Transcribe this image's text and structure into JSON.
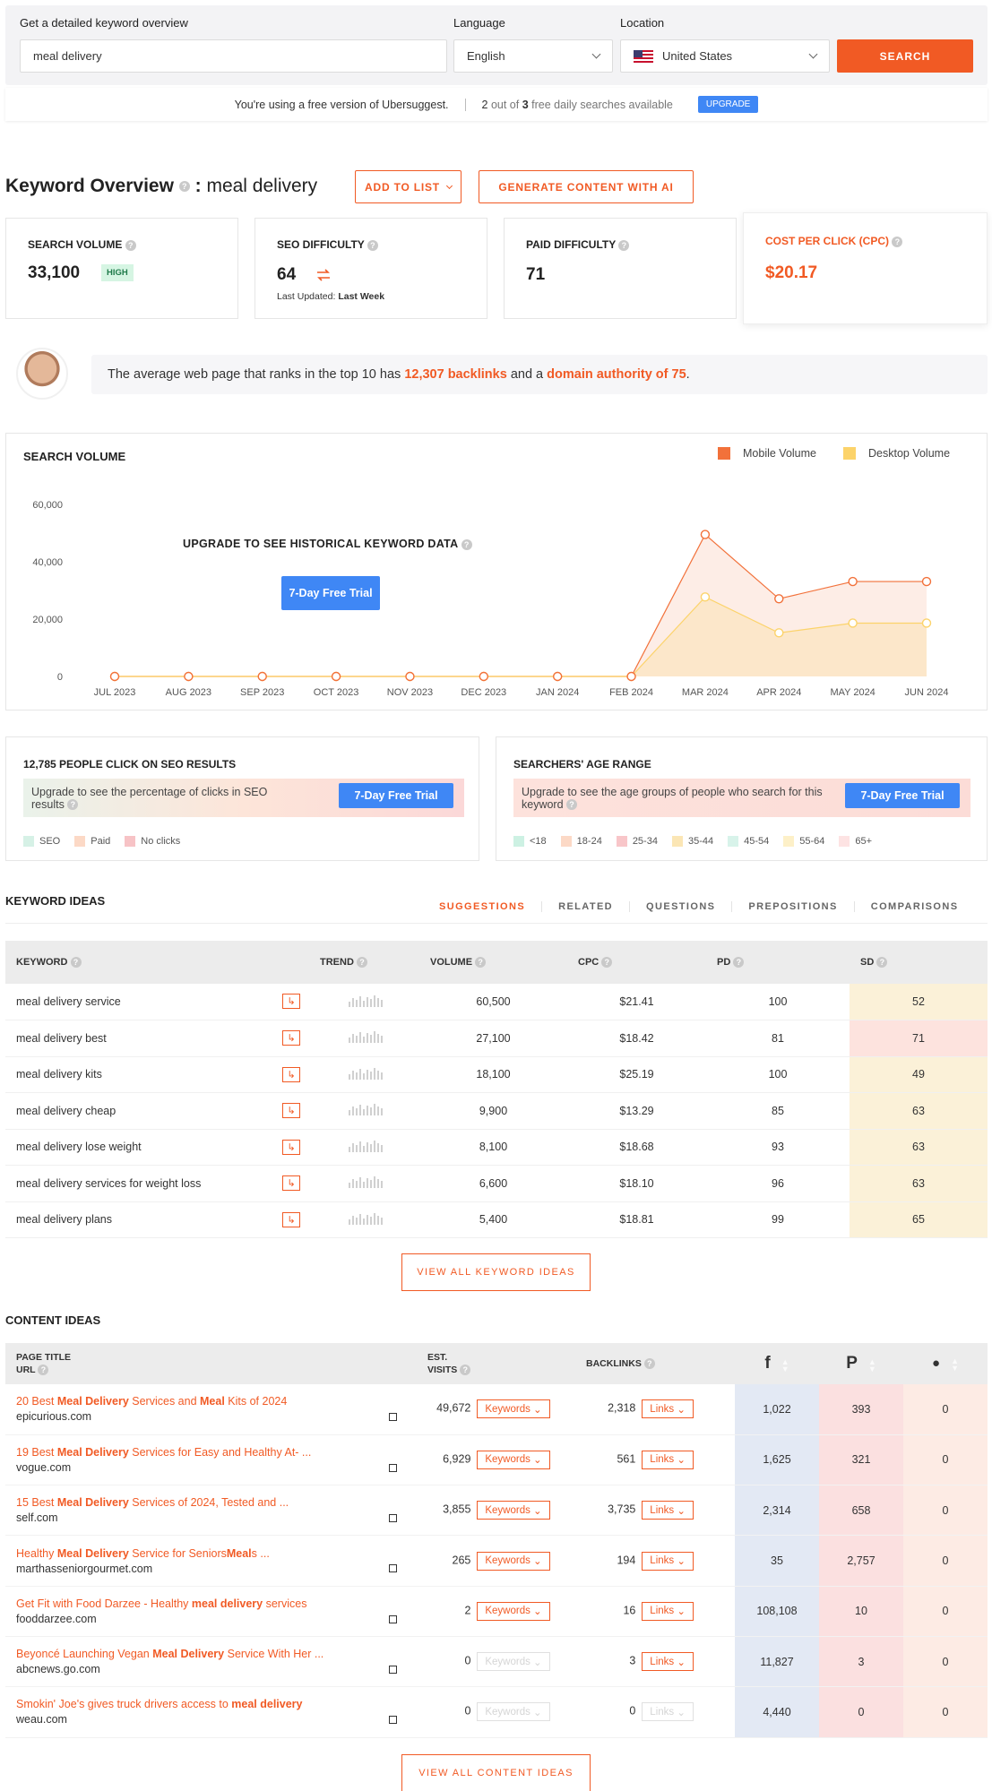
{
  "search": {
    "keyword_label": "Get a detailed keyword overview",
    "keyword_value": "meal delivery",
    "language_label": "Language",
    "language_value": "English",
    "location_label": "Location",
    "location_value": "United States",
    "button": "SEARCH"
  },
  "free_bar": {
    "message": "You're using a free version of Ubersuggest.",
    "count_used": "2",
    "count_of": "out of",
    "count_total": "3",
    "count_suffix": "free daily searches available",
    "upgrade": "UPGRADE"
  },
  "overview": {
    "title": "Keyword Overview",
    "colon": ":",
    "keyword": "meal delivery",
    "add_to_list": "ADD TO LIST",
    "generate": "GENERATE CONTENT WITH AI"
  },
  "metrics": {
    "search_volume_label": "SEARCH VOLUME",
    "search_volume": "33,100",
    "search_volume_badge": "HIGH",
    "seo_difficulty_label": "SEO DIFFICULTY",
    "seo_difficulty": "64",
    "last_updated_label": "Last Updated:",
    "last_updated": "Last Week",
    "paid_difficulty_label": "PAID DIFFICULTY",
    "paid_difficulty": "71",
    "cpc_label": "COST PER CLICK (CPC)",
    "cpc": "$20.17"
  },
  "tip": {
    "pre": "The average web page that ranks in the top 10 has",
    "backlinks": "12,307 backlinks",
    "mid": "and a",
    "authority": "domain authority of 75",
    "post": "."
  },
  "volume_chart": {
    "title": "SEARCH VOLUME",
    "legend_mobile": "Mobile Volume",
    "legend_desktop": "Desktop Volume",
    "upgrade_text": "UPGRADE TO SEE HISTORICAL KEYWORD DATA",
    "trial_button": "7-Day Free Trial",
    "colors": {
      "mobile": "#f2713a",
      "desktop": "#fcd36a"
    }
  },
  "chart_data": {
    "type": "line",
    "title": "SEARCH VOLUME",
    "x": [
      "JUL 2023",
      "AUG 2023",
      "SEP 2023",
      "OCT 2023",
      "NOV 2023",
      "DEC 2023",
      "JAN 2024",
      "FEB 2024",
      "MAR 2024",
      "APR 2024",
      "MAY 2024",
      "JUN 2024"
    ],
    "series": [
      {
        "name": "Mobile Volume",
        "values": [
          0,
          0,
          0,
          0,
          0,
          0,
          0,
          0,
          49500,
          27100,
          33100,
          33100
        ]
      },
      {
        "name": "Desktop Volume",
        "values": [
          0,
          0,
          0,
          0,
          0,
          0,
          0,
          0,
          27700,
          15200,
          18600,
          18600
        ]
      }
    ],
    "y_ticks": [
      "0",
      "20,000",
      "40,000",
      "60,000"
    ],
    "ylim": [
      0,
      60000
    ],
    "grid": false,
    "legend": "top-right"
  },
  "seo_clicks": {
    "title": "12,785 PEOPLE CLICK ON SEO RESULTS",
    "text": "Upgrade to see the percentage of clicks in SEO results",
    "button": "7-Day Free Trial",
    "legend": [
      "SEO",
      "Paid",
      "No clicks"
    ]
  },
  "age_range": {
    "title": "SEARCHERS' AGE RANGE",
    "text": "Upgrade to see the age groups of people who search for this keyword",
    "button": "7-Day Free Trial",
    "legend": [
      "<18",
      "18-24",
      "25-34",
      "35-44",
      "45-54",
      "55-64",
      "65+"
    ]
  },
  "keyword_ideas": {
    "title": "KEYWORD IDEAS",
    "tabs": [
      "SUGGESTIONS",
      "RELATED",
      "QUESTIONS",
      "PREPOSITIONS",
      "COMPARISONS"
    ],
    "headers": [
      "KEYWORD",
      "TREND",
      "VOLUME",
      "CPC",
      "PD",
      "SD"
    ],
    "rows": [
      {
        "keyword": "meal delivery service",
        "volume": "60,500",
        "cpc": "$21.41",
        "pd": "100",
        "sd": "52"
      },
      {
        "keyword": "meal delivery best",
        "volume": "27,100",
        "cpc": "$18.42",
        "pd": "81",
        "sd": "71"
      },
      {
        "keyword": "meal delivery kits",
        "volume": "18,100",
        "cpc": "$25.19",
        "pd": "100",
        "sd": "49"
      },
      {
        "keyword": "meal delivery cheap",
        "volume": "9,900",
        "cpc": "$13.29",
        "pd": "85",
        "sd": "63"
      },
      {
        "keyword": "meal delivery lose weight",
        "volume": "8,100",
        "cpc": "$18.68",
        "pd": "93",
        "sd": "63"
      },
      {
        "keyword": "meal delivery services for weight loss",
        "volume": "6,600",
        "cpc": "$18.10",
        "pd": "96",
        "sd": "63"
      },
      {
        "keyword": "meal delivery plans",
        "volume": "5,400",
        "cpc": "$18.81",
        "pd": "99",
        "sd": "65"
      }
    ],
    "view_all": "VIEW ALL KEYWORD IDEAS"
  },
  "content_ideas": {
    "title": "CONTENT IDEAS",
    "header_page_title": "PAGE TITLE",
    "header_url": "URL",
    "header_visits_1": "EST.",
    "header_visits_2": "VISITS",
    "header_backlinks": "BACKLINKS",
    "keywords_btn": "Keywords",
    "links_btn": "Links",
    "rows": [
      {
        "title_html": "20 Best <b>Meal Delivery</b> Services and <b>Meal</b> Kits of 2024",
        "url": "epicurious.com",
        "visits": "49,672",
        "backlinks": "2,318",
        "fb": "1,022",
        "pin": "393",
        "rd": "0",
        "kw_enabled": true,
        "links_enabled": true
      },
      {
        "title_html": "19 Best <b>Meal Delivery</b> Services for Easy and Healthy At- ...",
        "url": "vogue.com",
        "visits": "6,929",
        "backlinks": "561",
        "fb": "1,625",
        "pin": "321",
        "rd": "0",
        "kw_enabled": true,
        "links_enabled": true
      },
      {
        "title_html": "15 Best <b>Meal Delivery</b> Services of 2024, Tested and ...",
        "url": "self.com",
        "visits": "3,855",
        "backlinks": "3,735",
        "fb": "2,314",
        "pin": "658",
        "rd": "0",
        "kw_enabled": true,
        "links_enabled": true
      },
      {
        "title_html": "Healthy <b>Meal Delivery</b> Service for Seniors<b>Meal</b>s ...",
        "url": "marthasseniorgourmet.com",
        "visits": "265",
        "backlinks": "194",
        "fb": "35",
        "pin": "2,757",
        "rd": "0",
        "kw_enabled": true,
        "links_enabled": true
      },
      {
        "title_html": "Get Fit with Food Darzee - Healthy <b>meal delivery</b> services",
        "url": "fooddarzee.com",
        "visits": "2",
        "backlinks": "16",
        "fb": "108,108",
        "pin": "10",
        "rd": "0",
        "kw_enabled": true,
        "links_enabled": true
      },
      {
        "title_html": "Beyoncé Launching Vegan <b>Meal Delivery</b> Service With Her ...",
        "url": "abcnews.go.com",
        "visits": "0",
        "backlinks": "3",
        "fb": "11,827",
        "pin": "3",
        "rd": "0",
        "kw_enabled": false,
        "links_enabled": true
      },
      {
        "title_html": "Smokin' Joe's gives truck drivers access to <b>meal delivery</b>",
        "url": "weau.com",
        "visits": "0",
        "backlinks": "0",
        "fb": "4,440",
        "pin": "0",
        "rd": "0",
        "kw_enabled": false,
        "links_enabled": false
      }
    ],
    "view_all": "VIEW ALL CONTENT IDEAS"
  }
}
